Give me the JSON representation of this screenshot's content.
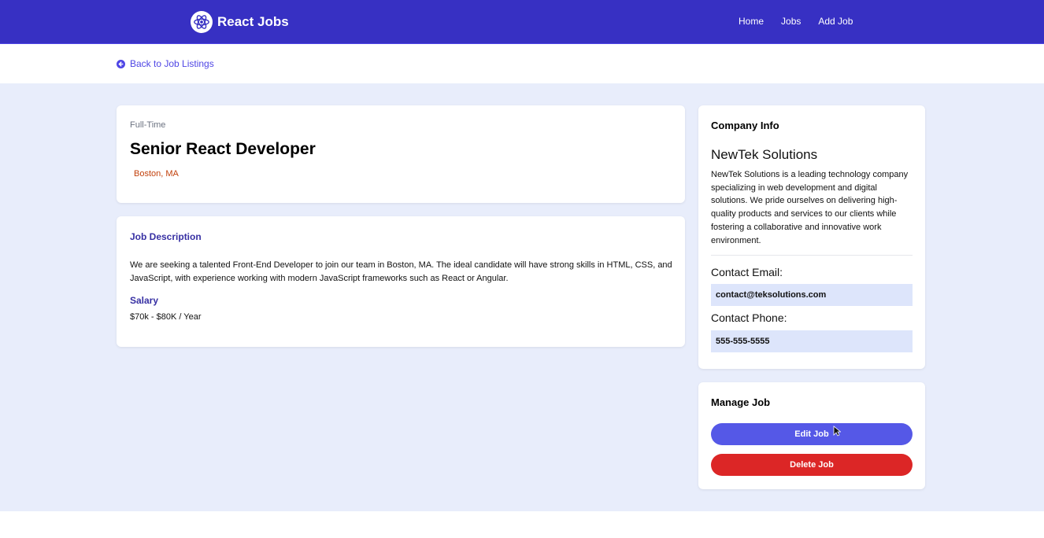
{
  "nav": {
    "brand": "React Jobs",
    "links": [
      "Home",
      "Jobs",
      "Add Job"
    ],
    "bg_color": "#3730c3"
  },
  "back": {
    "label": "Back to Job Listings"
  },
  "job": {
    "type": "Full-Time",
    "title": "Senior React Developer",
    "location": "Boston, MA",
    "description_heading": "Job Description",
    "description": "We are seeking a talented Front-End Developer to join our team in Boston, MA. The ideal candidate will have strong skills in HTML, CSS, and JavaScript, with experience working with modern JavaScript frameworks such as React or Angular.",
    "salary_heading": "Salary",
    "salary": "$70k - $80K / Year"
  },
  "company": {
    "heading": "Company Info",
    "name": "NewTek Solutions",
    "description": "NewTek Solutions is a leading technology company specializing in web development and digital solutions. We pride ourselves on delivering high-quality products and services to our clients while fostering a collaborative and innovative work environment.",
    "email_label": "Contact Email:",
    "email": "contact@teksolutions.com",
    "phone_label": "Contact Phone:",
    "phone": "555-555-5555"
  },
  "manage": {
    "heading": "Manage Job",
    "edit_label": "Edit Job",
    "delete_label": "Delete Job"
  },
  "icons": {
    "brand": "react-atom-icon",
    "back": "arrow-circle-left-icon",
    "location": "map-marker-icon",
    "cursor": "pointer-cursor-icon"
  }
}
